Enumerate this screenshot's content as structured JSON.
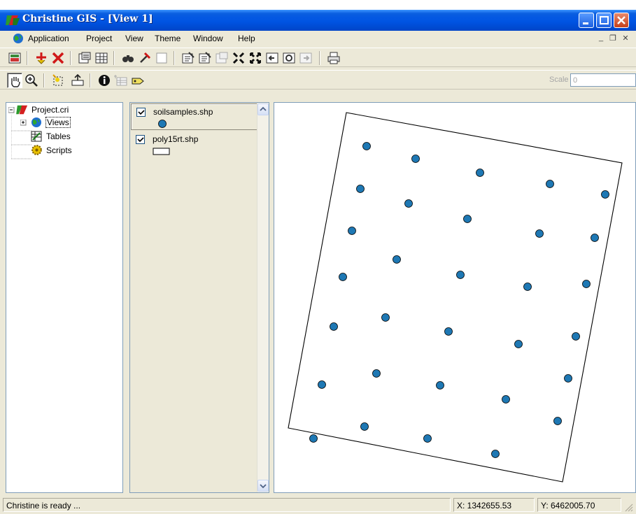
{
  "window": {
    "title": "Christine GIS - [View 1]"
  },
  "menubar": {
    "items": [
      "Application",
      "Project",
      "View",
      "Theme",
      "Window",
      "Help"
    ],
    "mdi_controls": [
      "_",
      "❐",
      "✕"
    ]
  },
  "toolbar_top": {
    "tools": [
      "open-project-icon",
      "add-theme-icon",
      "delete-theme-icon",
      "properties-icon",
      "table-icon",
      "find-icon",
      "query-icon",
      "blank-icon",
      "legend-edit-icon",
      "legend-edit-2-icon",
      "disabled-legend-icon",
      "zoom-full-icon",
      "zoom-extent-icon",
      "zoom-previous-icon",
      "zoom-refresh-icon",
      "disabled-next-icon",
      "print-icon"
    ]
  },
  "toolbar_second": {
    "tools": [
      "pan-hand-icon",
      "zoom-in-icon",
      "select-icon",
      "export-icon",
      "info-icon",
      "disabled-table-icon",
      "label-icon"
    ],
    "scale_label": "Scale 1:",
    "scale_value": "0"
  },
  "project_tree": {
    "root": "Project.cri",
    "items": [
      {
        "label": "Views",
        "icon": "globe-icon",
        "expandable": true,
        "selected": true
      },
      {
        "label": "Tables",
        "icon": "table-grid-icon",
        "expandable": false
      },
      {
        "label": "Scripts",
        "icon": "script-gear-icon",
        "expandable": false
      }
    ]
  },
  "legend": {
    "themes": [
      {
        "name": "soilsamples.shp",
        "checked": true,
        "symbol": "point",
        "color": "#1e78b4"
      },
      {
        "name": "poly15rt.shp",
        "checked": true,
        "symbol": "polygon",
        "color": "#ffffff"
      }
    ]
  },
  "map": {
    "point_color": "#1e78b4",
    "polygon_outline": "#000000"
  },
  "status": {
    "message": "Christine is ready ...",
    "x_coord": "X: 1342655.53",
    "y_coord": "Y: 6462005.70"
  },
  "colors": {
    "title_bar": "#0054e3",
    "face": "#ece9d8",
    "border": "#7f9db9"
  }
}
